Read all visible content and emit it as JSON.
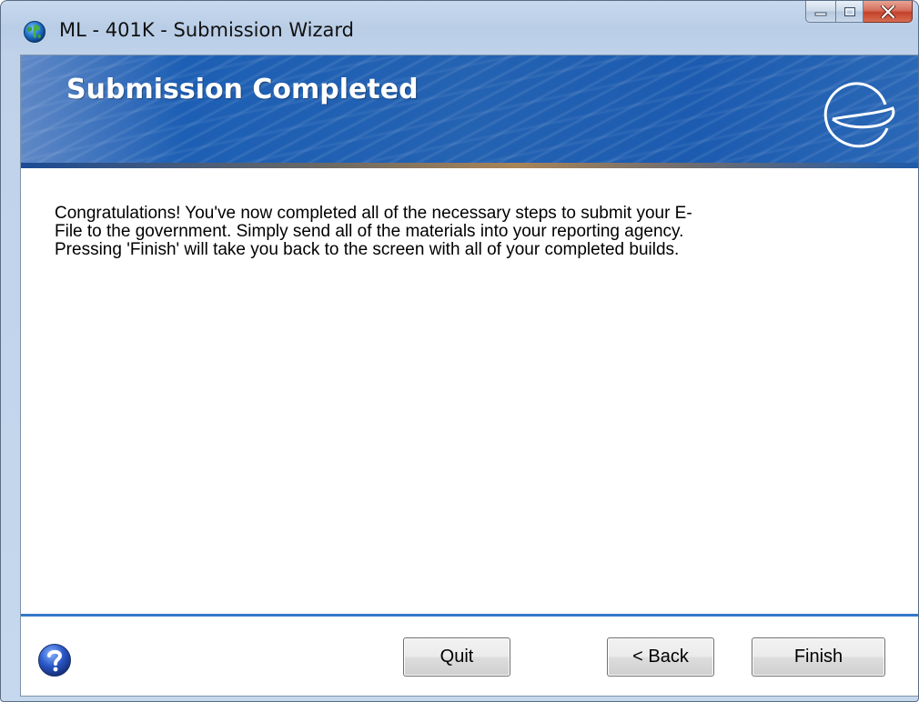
{
  "window": {
    "title": "ML - 401K - Submission Wizard",
    "app_icon": "globe-icon"
  },
  "caption_buttons": {
    "minimize": "minimize-icon",
    "maximize": "maximize-icon",
    "close": "close-icon"
  },
  "banner": {
    "title": "Submission Completed",
    "logo": "e-logo-icon"
  },
  "message": {
    "lines": [
      "Congratulations!  You've now completed all of the necessary steps to submit your E-",
      "File to the government.  Simply send all of the materials into your reporting agency.",
      "Pressing 'Finish' will take you back to the screen with all of your completed builds."
    ]
  },
  "footer": {
    "help_icon": "help-icon",
    "quit_label": "Quit",
    "back_label": "< Back",
    "finish_label": "Finish"
  },
  "colors": {
    "banner_blue": "#1d5fb4",
    "footer_rule": "#3579c8",
    "close_red": "#c4412a"
  }
}
